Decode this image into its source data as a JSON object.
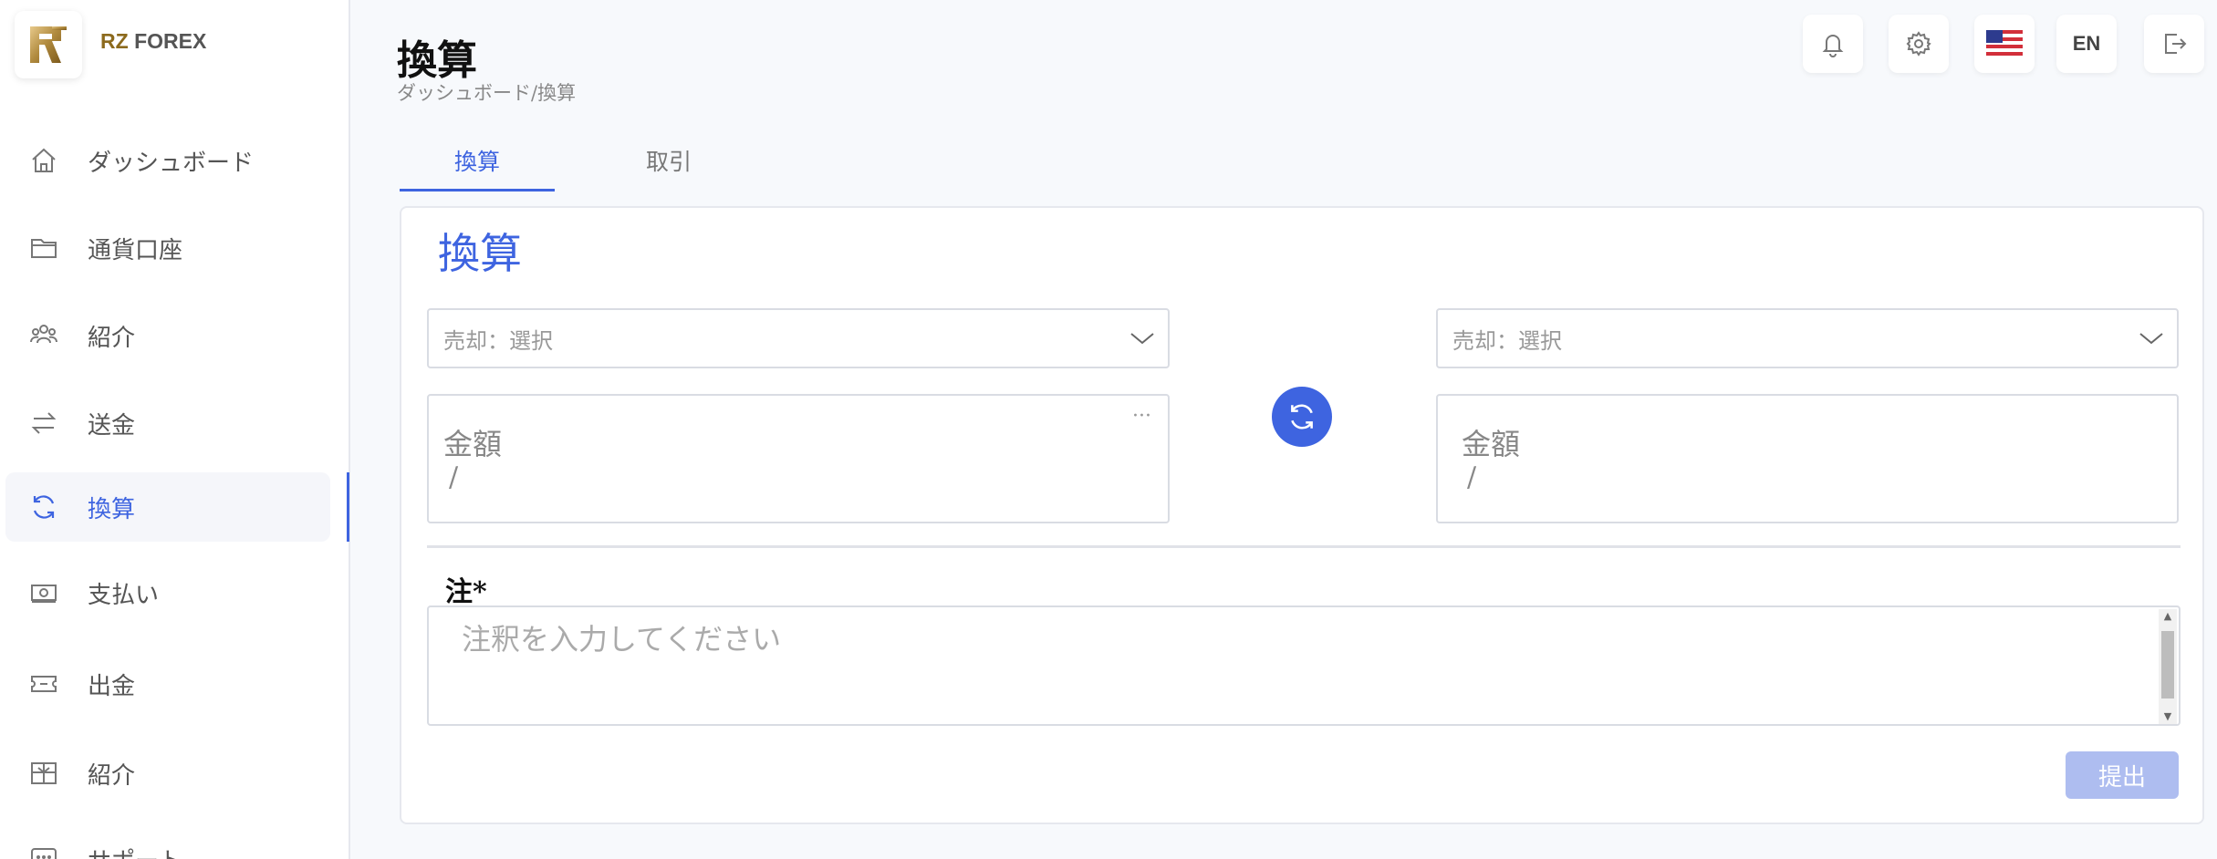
{
  "brand": {
    "prefix": "RZ",
    "name": "FOREX"
  },
  "sidebar": {
    "items": [
      {
        "label": "ダッシュボード",
        "icon": "home-icon"
      },
      {
        "label": "通貨口座",
        "icon": "folder-icon"
      },
      {
        "label": "紹介",
        "icon": "users-icon"
      },
      {
        "label": "送金",
        "icon": "transfer-icon"
      },
      {
        "label": "換算",
        "icon": "refresh-icon",
        "active": true
      },
      {
        "label": "支払い",
        "icon": "cash-icon"
      },
      {
        "label": "出金",
        "icon": "ticket-icon"
      },
      {
        "label": "紹介",
        "icon": "gift-icon"
      },
      {
        "label": "サポート",
        "icon": "chat-icon"
      }
    ]
  },
  "header": {
    "title": "換算",
    "breadcrumb": "ダッシュボード/換算",
    "language": "EN"
  },
  "tabs": [
    {
      "label": "換算",
      "active": true
    },
    {
      "label": "取引",
      "active": false
    }
  ],
  "card": {
    "title": "換算",
    "left": {
      "select_placeholder": "売却：選択",
      "amount_label": "金額",
      "amount_value": "/"
    },
    "right": {
      "select_placeholder": "売却：選択",
      "amount_label": "金額",
      "amount_value": "/"
    },
    "note_label": "注*",
    "note_placeholder": "注釈を入力してください",
    "submit_label": "提出"
  },
  "colors": {
    "accent": "#3e64e0",
    "submit_disabled": "#aebdf0",
    "brand_gold": "#8c6a1d"
  }
}
